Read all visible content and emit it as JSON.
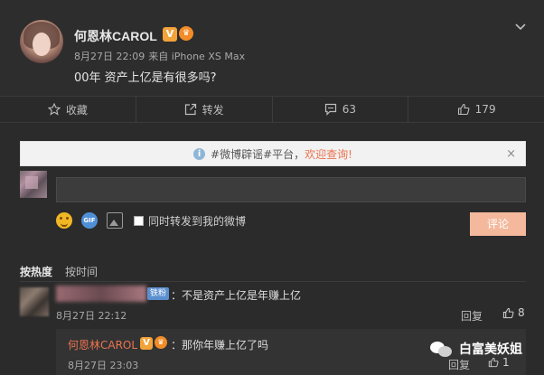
{
  "post": {
    "user_name": "何恩林CAROL",
    "v_badge": "V",
    "time": "8月27日 22:09",
    "source": "来自 iPhone XS Max",
    "text": "00年 资产上亿是有很多吗?"
  },
  "actions": {
    "favorite_label": "收藏",
    "forward_label": "转发",
    "comment_count": "63",
    "like_count": "179"
  },
  "notice": {
    "text_prefix": "#微博辟谣#平台，",
    "text_highlight": "欢迎查询!",
    "close": "×"
  },
  "composer": {
    "gif_label": "GIF",
    "checkbox_label": "同时转发到我的微博",
    "submit_label": "评论"
  },
  "sort": {
    "hot_label": "按热度",
    "time_label": "按时间"
  },
  "comments": [
    {
      "badge": "铁粉",
      "text": "：不是资产上亿是年赚上亿",
      "time": "8月27日 22:12",
      "reply_label": "回复",
      "likes": "8"
    }
  ],
  "reply": {
    "user_name": "何恩林CAROL",
    "v_badge": "V",
    "text": "：那你年赚上亿了吗",
    "time": "8月27日 23:03",
    "reply_label": "回复",
    "likes": "1"
  },
  "watermark": {
    "text": "白富美妖姐"
  },
  "colors": {
    "background": "#2b2b2b",
    "accent": "#eb7350",
    "submit": "#f4b89c"
  }
}
